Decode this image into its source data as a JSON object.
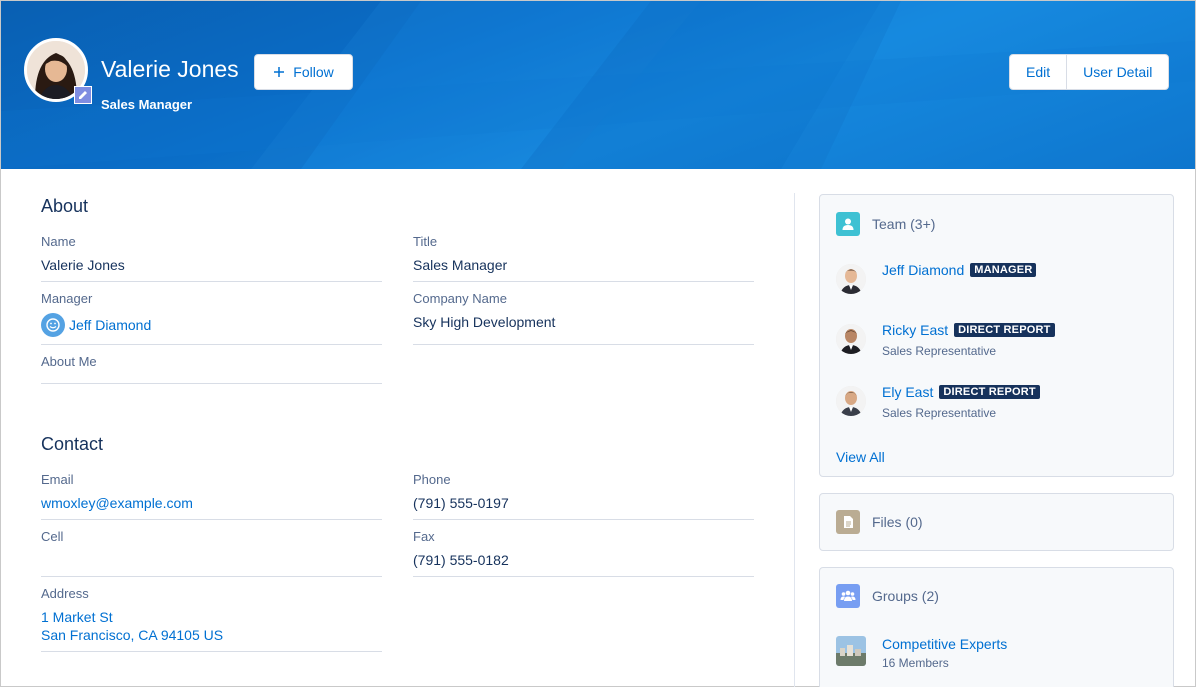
{
  "header": {
    "name": "Valerie Jones",
    "title": "Sales Manager",
    "follow_label": "Follow",
    "edit_label": "Edit",
    "user_detail_label": "User Detail"
  },
  "about": {
    "heading": "About",
    "name_label": "Name",
    "name_value": "Valerie Jones",
    "title_label": "Title",
    "title_value": "Sales Manager",
    "manager_label": "Manager",
    "manager_value": "Jeff Diamond",
    "company_label": "Company Name",
    "company_value": "Sky High Development",
    "about_me_label": "About Me"
  },
  "contact": {
    "heading": "Contact",
    "email_label": "Email",
    "email_value": "wmoxley@example.com",
    "phone_label": "Phone",
    "phone_value": "(791) 555-0197",
    "cell_label": "Cell",
    "fax_label": "Fax",
    "fax_value": "(791) 555-0182",
    "address_label": "Address",
    "address_line1": "1 Market St",
    "address_line2": "San Francisco, CA 94105 US"
  },
  "team": {
    "title": "Team (3+)",
    "members": [
      {
        "name": "Jeff Diamond",
        "badge": "MANAGER",
        "role": ""
      },
      {
        "name": "Ricky East",
        "badge": "DIRECT REPORT",
        "role": "Sales Representative"
      },
      {
        "name": "Ely East",
        "badge": "DIRECT REPORT",
        "role": "Sales Representative"
      }
    ],
    "view_all": "View All"
  },
  "files": {
    "title": "Files (0)"
  },
  "groups": {
    "title": "Groups (2)",
    "items": [
      {
        "name": "Competitive Experts",
        "members": "16 Members"
      }
    ]
  },
  "colors": {
    "brand_blue": "#0070d2",
    "header_blue": "#0b73cf",
    "team_icon": "#3ec1d3",
    "files_icon": "#baac93",
    "groups_icon": "#779ef2",
    "badge_bg": "#16325c"
  }
}
